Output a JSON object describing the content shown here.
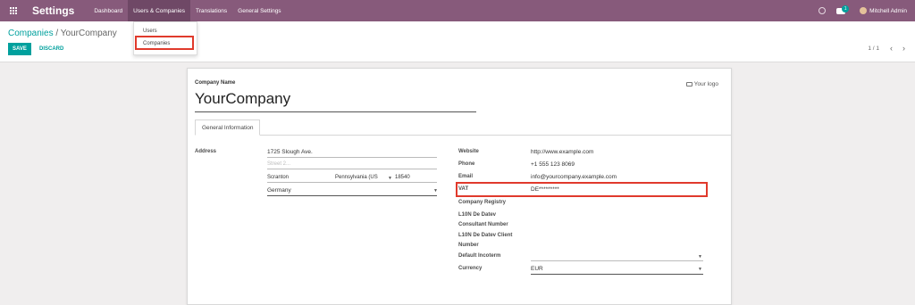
{
  "navbar": {
    "brand": "Settings",
    "menu": [
      "Dashboard",
      "Users & Companies",
      "Translations",
      "General Settings"
    ],
    "chat_count": "1",
    "user_name": "Mitchell Admin"
  },
  "dropdown": {
    "items": [
      "Users",
      "Companies"
    ]
  },
  "control_panel": {
    "breadcrumb_parent": "Companies",
    "breadcrumb_sep": "/",
    "breadcrumb_current": "YourCompany",
    "save_label": "SAVE",
    "discard_label": "DISCARD",
    "pager": "1 / 1",
    "prev": "‹",
    "next": "›"
  },
  "form": {
    "company_name_label": "Company Name",
    "company_name": "YourCompany",
    "logo_label": "Your logo",
    "tab_general": "General Information",
    "address_label": "Address",
    "street": "1725 Slough Ave.",
    "street2_placeholder": "Street 2...",
    "city": "Scranton",
    "state": "Pennsylvania (US",
    "zip": "18540",
    "country": "Germany",
    "website_label": "Website",
    "website": "http://www.example.com",
    "phone_label": "Phone",
    "phone": "+1 555 123 8069",
    "email_label": "Email",
    "email": "info@yourcompany.example.com",
    "vat_label": "VAT",
    "vat": "DE*********",
    "registry_label": "Company Registry",
    "datev_consultant_label_1": "L10N De Datev",
    "datev_consultant_label_2": "Consultant Number",
    "datev_client_label_1": "L10N De Datev Client",
    "datev_client_label_2": "Number",
    "incoterm_label": "Default Incoterm",
    "currency_label": "Currency",
    "currency": "EUR"
  },
  "colors": {
    "brand": "#875a7b",
    "accent": "#00a09d",
    "highlight": "#e03a2c"
  }
}
